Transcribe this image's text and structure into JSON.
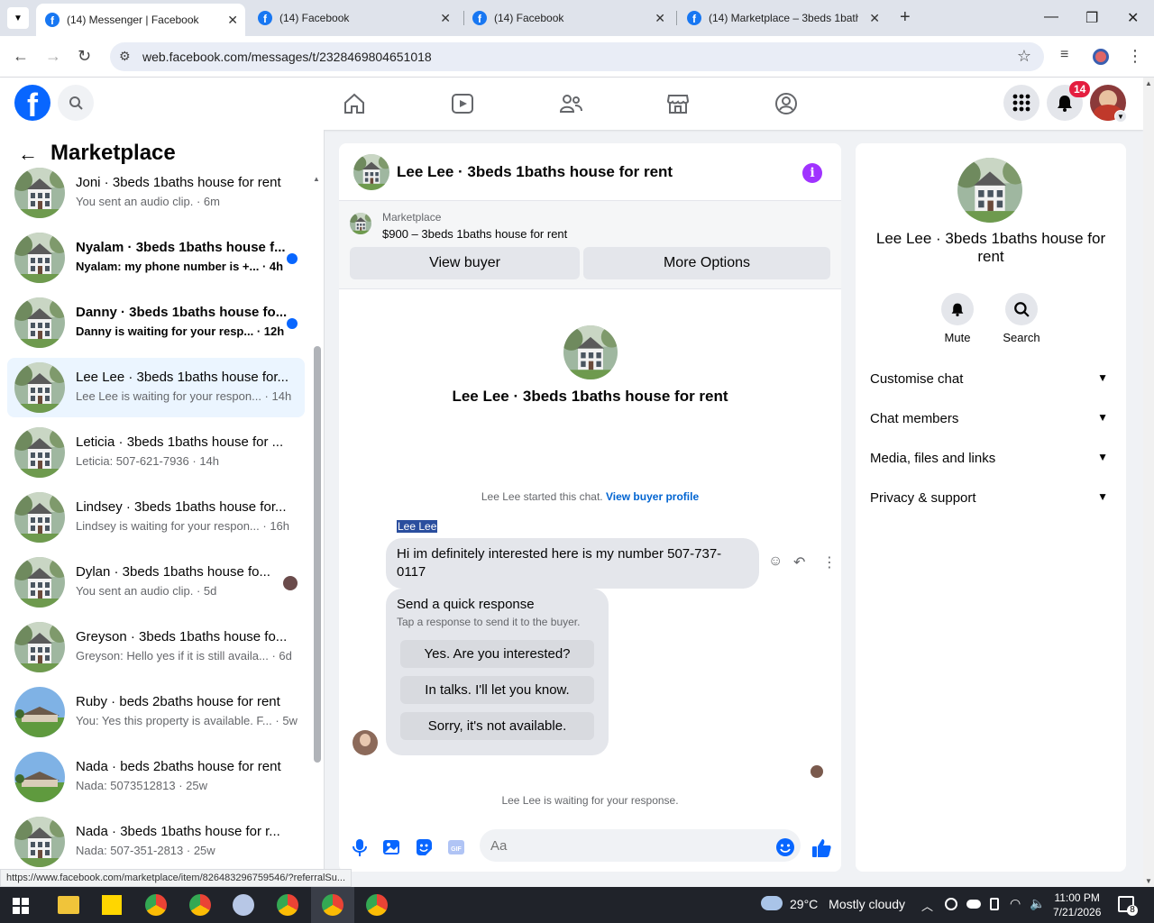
{
  "browser": {
    "tabs": [
      {
        "title": "(14) Messenger | Facebook",
        "active": true
      },
      {
        "title": "(14) Facebook",
        "active": false
      },
      {
        "title": "(14) Facebook",
        "active": false
      },
      {
        "title": "(14) Marketplace – 3beds 1bath",
        "active": false
      }
    ],
    "url": "web.facebook.com/messages/t/2328469804651018",
    "status_hint": "https://www.facebook.com/marketplace/item/826483296759546/?referralSu..."
  },
  "fbnav": {
    "notification_count": "14"
  },
  "sidebar": {
    "title": "Marketplace",
    "conversations": [
      {
        "name": "Joni · 3beds 1baths house for rent",
        "preview": "You sent an audio clip. · 6m",
        "unread": false
      },
      {
        "name": "Nyalam · 3beds 1baths house f...",
        "preview": "Nyalam: my phone number is +... · 4h",
        "unread": true
      },
      {
        "name": "Danny · 3beds 1baths house fo...",
        "preview": "Danny is waiting for your resp... · 12h",
        "unread": true
      },
      {
        "name": "Lee Lee · 3beds 1baths house for...",
        "preview": "Lee Lee is waiting for your respon... · 14h",
        "unread": false,
        "active": true
      },
      {
        "name": "Leticia · 3beds 1baths house for ...",
        "preview": "Leticia: 507-621-7936 · 14h",
        "unread": false
      },
      {
        "name": "Lindsey · 3beds 1baths house for...",
        "preview": "Lindsey is waiting for your respon... · 16h",
        "unread": false
      },
      {
        "name": "Dylan · 3beds 1baths house fo...",
        "preview": "You sent an audio clip. · 5d",
        "unread": false,
        "seen": true
      },
      {
        "name": "Greyson · 3beds 1baths house fo...",
        "preview": "Greyson: Hello yes if it is still availa... · 6d",
        "unread": false
      },
      {
        "name": "Ruby · beds 2baths house for rent",
        "preview": "You: Yes this property is available. F... · 5w",
        "unread": false
      },
      {
        "name": "Nada · beds 2baths house for rent",
        "preview": "Nada: 5073512813 · 25w",
        "unread": false
      },
      {
        "name": "Nada · 3beds 1baths house for r...",
        "preview": "Nada: 507-351-2813 · 25w",
        "unread": false
      }
    ]
  },
  "chat": {
    "title": "Lee Lee · 3beds 1baths house for rent",
    "marketplace_label": "Marketplace",
    "listing": "$900 – 3beds 1baths house for rent",
    "view_buyer": "View buyer",
    "more_options": "More Options",
    "intro_name": "Lee Lee · 3beds 1baths house for rent",
    "started_text": "Lee Lee started this chat.",
    "view_buyer_profile": "View buyer profile",
    "sender": "Lee Lee",
    "message": "Hi im definitely interested here is my number 507-737-0117",
    "quick_title": "Send a quick response",
    "quick_subtitle": "Tap a response to send it to the buyer.",
    "quick_responses": [
      "Yes. Are you interested?",
      "In talks. I'll let you know.",
      "Sorry, it's not available."
    ],
    "waiting": "Lee Lee is waiting for your response.",
    "input_placeholder": "Aa"
  },
  "rpanel": {
    "name": "Lee Lee · 3beds 1baths house for rent",
    "mute": "Mute",
    "search": "Search",
    "sections": [
      "Customise chat",
      "Chat members",
      "Media, files and links",
      "Privacy & support"
    ]
  },
  "taskbar": {
    "temperature": "29°C",
    "weather": "Mostly cloudy",
    "time": "11:00 PM",
    "date": "7/21/2026",
    "notif_count": "8"
  },
  "colors": {
    "fb_blue": "#0866ff",
    "info_purple": "#a033ff",
    "badge_red": "#e41e3f",
    "link_blue": "#0064d1"
  }
}
